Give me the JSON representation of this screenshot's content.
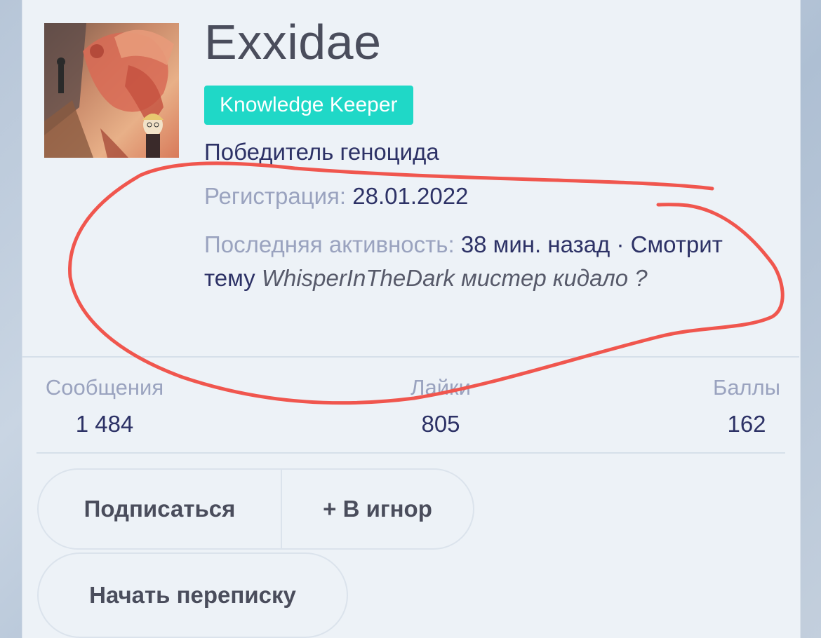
{
  "profile": {
    "username": "Exxidae",
    "badge": "Knowledge Keeper",
    "user_title": "Победитель геноцида",
    "registration_label": "Регистрация:",
    "registration_value": "28.01.2022",
    "activity_label": "Последняя активность:",
    "activity_time": "38 мин. назад ·",
    "activity_action": "Смотрит тему",
    "activity_topic": "WhisperInTheDark мистер кидало ?"
  },
  "stats": [
    {
      "label": "Сообщения",
      "value": "1 484"
    },
    {
      "label": "Лайки",
      "value": "805"
    },
    {
      "label": "Баллы",
      "value": "162"
    }
  ],
  "buttons": {
    "follow": "Подписаться",
    "ignore": "+ В игнор",
    "message": "Начать переписку"
  },
  "colors": {
    "badge": "#1fd8c7",
    "annotation": "#f0564e",
    "card_bg": "#edf2f7"
  }
}
